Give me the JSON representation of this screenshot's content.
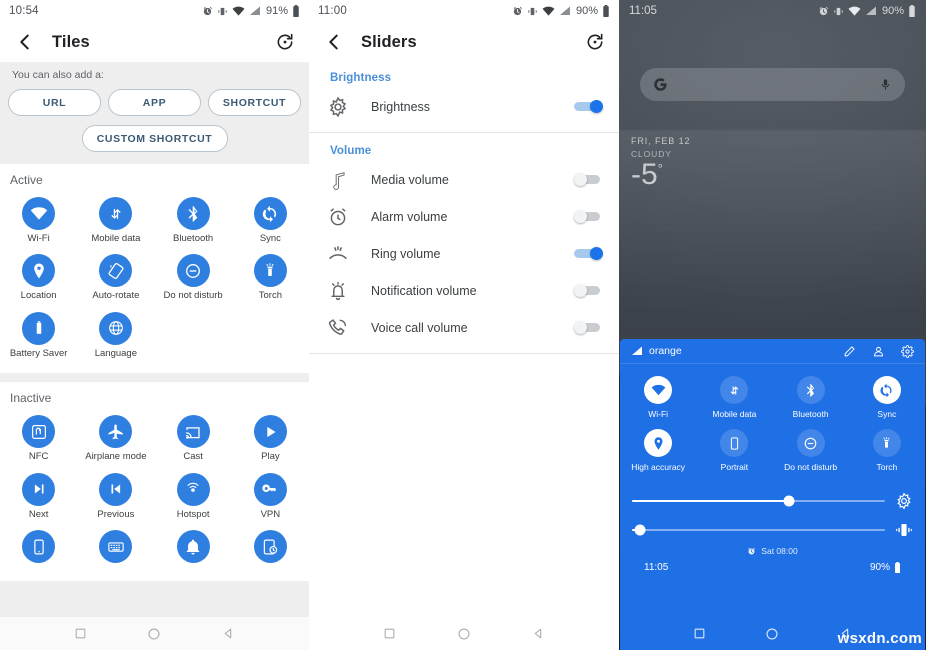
{
  "panel_tiles": {
    "status_bar": {
      "time": "10:54",
      "battery": "91%"
    },
    "appbar": {
      "title": "Tiles",
      "back_icon": "back-arrow-icon",
      "restore_icon": "restore-icon"
    },
    "add_section": {
      "hint": "You can also add a:",
      "buttons": [
        "URL",
        "APP",
        "SHORTCUT"
      ],
      "custom": "CUSTOM SHORTCUT"
    },
    "active": {
      "title": "Active",
      "tiles": [
        {
          "label": "Wi-Fi",
          "icon": "wifi-icon"
        },
        {
          "label": "Mobile data",
          "icon": "mobile-data-icon"
        },
        {
          "label": "Bluetooth",
          "icon": "bluetooth-icon"
        },
        {
          "label": "Sync",
          "icon": "sync-icon"
        },
        {
          "label": "Location",
          "icon": "location-pin-icon"
        },
        {
          "label": "Auto-rotate",
          "icon": "auto-rotate-icon"
        },
        {
          "label": "Do not disturb",
          "icon": "do-not-disturb-icon"
        },
        {
          "label": "Torch",
          "icon": "torch-icon"
        },
        {
          "label": "Battery Saver",
          "icon": "battery-icon"
        },
        {
          "label": "Language",
          "icon": "globe-icon"
        }
      ]
    },
    "inactive": {
      "title": "Inactive",
      "tiles": [
        {
          "label": "NFC",
          "icon": "nfc-icon"
        },
        {
          "label": "Airplane mode",
          "icon": "airplane-icon"
        },
        {
          "label": "Cast",
          "icon": "cast-icon"
        },
        {
          "label": "Play",
          "icon": "play-icon"
        },
        {
          "label": "Next",
          "icon": "next-track-icon"
        },
        {
          "label": "Previous",
          "icon": "previous-track-icon"
        },
        {
          "label": "Hotspot",
          "icon": "hotspot-icon"
        },
        {
          "label": "VPN",
          "icon": "vpn-key-icon"
        },
        {
          "label": "",
          "icon": "phone-icon"
        },
        {
          "label": "",
          "icon": "keyboard-icon"
        },
        {
          "label": "",
          "icon": "bell-icon"
        },
        {
          "label": "",
          "icon": "screenshot-icon"
        }
      ]
    }
  },
  "panel_sliders": {
    "status_bar": {
      "time": "11:00",
      "battery": "90%"
    },
    "appbar": {
      "title": "Sliders",
      "back_icon": "back-arrow-icon",
      "restore_icon": "restore-icon"
    },
    "brightness_section": {
      "header": "Brightness",
      "rows": [
        {
          "label": "Brightness",
          "icon": "brightness-icon",
          "enabled": true
        }
      ]
    },
    "volume_section": {
      "header": "Volume",
      "rows": [
        {
          "label": "Media volume",
          "icon": "music-note-icon",
          "enabled": false
        },
        {
          "label": "Alarm volume",
          "icon": "alarm-clock-icon",
          "enabled": false
        },
        {
          "label": "Ring volume",
          "icon": "ring-icon",
          "enabled": true
        },
        {
          "label": "Notification volume",
          "icon": "notification-bell-icon",
          "enabled": false
        },
        {
          "label": "Voice call volume",
          "icon": "voice-call-icon",
          "enabled": false
        }
      ]
    }
  },
  "panel_home": {
    "status_bar": {
      "time": "11:05",
      "battery": "90%"
    },
    "search": {
      "logo": "google-g-icon",
      "mic": "microphone-icon"
    },
    "weather": {
      "date": "FRI, FEB 12",
      "condition": "CLOUDY",
      "temp": "-5",
      "degree": "°"
    },
    "quick_settings": {
      "carrier": "orange",
      "carrier_icon": "signal-icon",
      "header_icons": [
        "edit-pencil-icon",
        "user-account-icon",
        "settings-gear-icon"
      ],
      "tiles": [
        {
          "label": "Wi-Fi",
          "icon": "wifi-icon",
          "active": true
        },
        {
          "label": "Mobile data",
          "icon": "mobile-data-icon",
          "active": false
        },
        {
          "label": "Bluetooth",
          "icon": "bluetooth-icon",
          "active": false
        },
        {
          "label": "Sync",
          "icon": "sync-icon",
          "active": true
        },
        {
          "label": "High accuracy",
          "icon": "location-pin-icon",
          "active": true
        },
        {
          "label": "Portrait",
          "icon": "portrait-icon",
          "active": false
        },
        {
          "label": "Do not disturb",
          "icon": "do-not-disturb-icon",
          "active": false
        },
        {
          "label": "Torch",
          "icon": "torch-icon",
          "active": false
        }
      ],
      "sliders": [
        {
          "name": "brightness",
          "icon": "brightness-icon",
          "value": 62
        },
        {
          "name": "volume",
          "icon": "vibrate-icon",
          "value": 3
        }
      ],
      "alarm": {
        "icon": "alarm-clock-icon",
        "text": "Sat 08:00"
      },
      "footer": {
        "time": "11:05",
        "battery": "90%"
      }
    },
    "watermark": "wsxdn.com"
  },
  "nav_bar": {
    "recents": "square-icon",
    "home": "circle-icon",
    "back": "triangle-back-icon"
  },
  "colors": {
    "tile_blue": "#2f7fe0",
    "qs_blue": "#1f6fe5",
    "accent_header": "#4a90d9",
    "pill_text": "#3c5a73"
  }
}
